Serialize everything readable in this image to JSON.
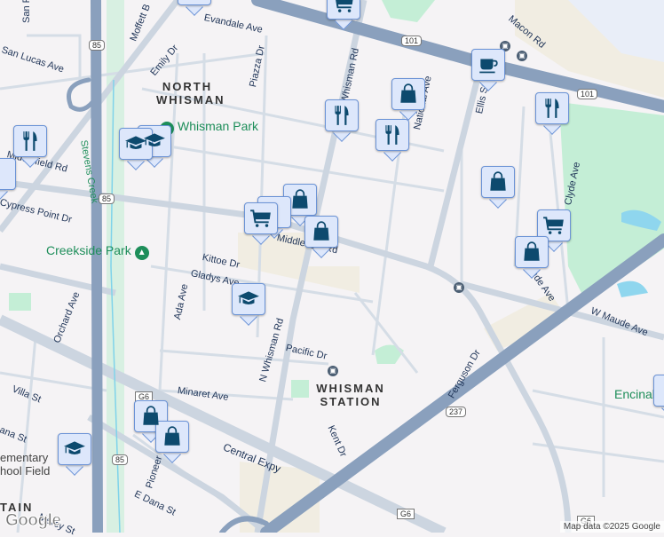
{
  "map": {
    "areas": {
      "north_whisman": "NORTH WHISMAN",
      "whisman_station": "WHISMAN STATION",
      "mountain_partial": "TAIN"
    },
    "parks": {
      "whisman_park": "Whisman Park",
      "creekside_park": "Creekside Park",
      "encinal": "Encinal",
      "school_field": "ementary\nhool Field"
    },
    "streets": {
      "evandale": "Evandale Ave",
      "moffett": "Moffett B",
      "san_lucas": "San Lucas Ave",
      "emily": "Emily Dr",
      "piazza": "Piazza Dr",
      "whisman_rd": "Whisman Rd",
      "national": "National Ave",
      "ellis": "Ellis St",
      "macon": "Macon Rd",
      "clyde": "Clyde Ave",
      "middlefield_w": "Middlefield Rd",
      "middlefield_e": "Middlefield Rd",
      "cypress": "Cypress Point Dr",
      "kittoe": "Kittoe Dr",
      "gladys": "Gladys Ave",
      "ada": "Ada Ave",
      "orchard": "Orchard Ave",
      "n_whisman": "N Whisman Rd",
      "pacific": "Pacific Dr",
      "minaret": "Minaret Ave",
      "villa": "Villa St",
      "dana": "E Dana St",
      "dana_w": "ana St",
      "pioneer": "Pioneer",
      "central": "Central Expy",
      "kent": "Kent Dr",
      "ferguson": "Ferguson Dr",
      "maude": "W Maude Ave",
      "maude_n": "ude Ave",
      "mercy": "Mercy St",
      "stevens": "Stevens Creek",
      "san_partial": "San P"
    },
    "shields": {
      "r85a": "85",
      "r85b": "85",
      "r85c": "85",
      "r101a": "101",
      "r101b": "101",
      "r237": "237",
      "g6a": "G6",
      "g6b": "G6",
      "g6c": "G6"
    },
    "attribution": "Map data ©2025 Google",
    "logo": "Google",
    "colors": {
      "freeway": "#8aa0bd",
      "road": "#d5dde6",
      "park": "#c4eed6",
      "pin_fill": "#dde7fb",
      "pin_border": "#6b93d6",
      "icon": "#0d4a6e",
      "label": "#1f3457",
      "park_text": "#1e8e5a"
    }
  }
}
